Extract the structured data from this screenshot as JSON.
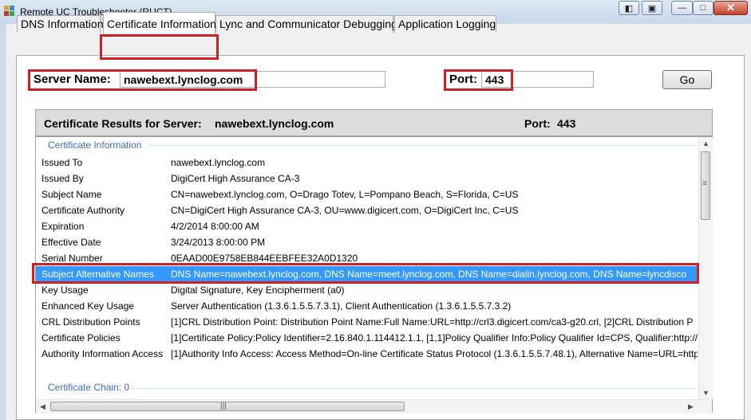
{
  "window": {
    "title": "Remote UC Troubleshooter (RUCT)",
    "buttons": {
      "restore": "◧",
      "pin": "▣",
      "minimize": "—",
      "maximize": "□",
      "close": "✕"
    }
  },
  "tabs": [
    {
      "label": "DNS Information"
    },
    {
      "label": "Certificate Information",
      "active": true
    },
    {
      "label": "Lync and Communicator Debugging"
    },
    {
      "label": "Application Logging"
    }
  ],
  "form": {
    "server_label": "Server Name:",
    "server_value": "nawebext.lynclog.com",
    "port_label": "Port:",
    "port_value": "443",
    "go_label": "Go"
  },
  "results": {
    "header_label": "Certificate Results for Server:",
    "header_server": "nawebext.lynclog.com",
    "header_port_label": "Port:",
    "header_port": "443",
    "group_title": "Certificate Information",
    "chain_title": "Certificate Chain: 0",
    "rows": [
      {
        "key": "Issued To",
        "value": "nawebext.lynclog.com"
      },
      {
        "key": "Issued By",
        "value": "DigiCert High Assurance CA-3"
      },
      {
        "key": "Subject Name",
        "value": "CN=nawebext.lynclog.com, O=Drago Totev, L=Pompano Beach, S=Florida, C=US"
      },
      {
        "key": "Certificate Authority",
        "value": "CN=DigiCert High Assurance CA-3, OU=www.digicert.com, O=DigiCert Inc, C=US"
      },
      {
        "key": "Expiration",
        "value": "4/2/2014 8:00:00 AM"
      },
      {
        "key": "Effective Date",
        "value": "3/24/2013 8:00:00 PM"
      },
      {
        "key": "Serial Number",
        "value": "0EAAD00E9758EB844EEBFEE32A0D1320"
      },
      {
        "key": "Subject Alternative Names",
        "value": "DNS Name=nawebext.lynclog.com, DNS Name=meet.lynclog.com, DNS Name=dialin.lynclog.com, DNS Name=lyncdisco",
        "selected": true
      },
      {
        "key": "Key Usage",
        "value": "Digital Signature, Key Encipherment (a0)"
      },
      {
        "key": "Enhanced Key Usage",
        "value": "Server Authentication (1.3.6.1.5.5.7.3.1), Client Authentication (1.3.6.1.5.5.7.3.2)"
      },
      {
        "key": "CRL Distribution Points",
        "value": "[1]CRL Distribution Point: Distribution Point Name:Full Name:URL=http://crl3.digicert.com/ca3-g20.crl, [2]CRL Distribution P"
      },
      {
        "key": "Certificate Policies",
        "value": "[1]Certificate Policy:Policy Identifier=2.16.840.1.114412.1.1, [1,1]Policy Qualifier Info:Policy Qualifier Id=CPS, Qualifier:http://"
      },
      {
        "key": "Authority Information Access",
        "value": "[1]Authority Info Access: Access Method=On-line Certificate Status Protocol (1.3.6.1.5.5.7.48.1), Alternative Name=URL=http"
      }
    ]
  },
  "colors": {
    "highlight": "#d02027",
    "selection": "#3399ff",
    "group_title": "#3c6db0"
  }
}
